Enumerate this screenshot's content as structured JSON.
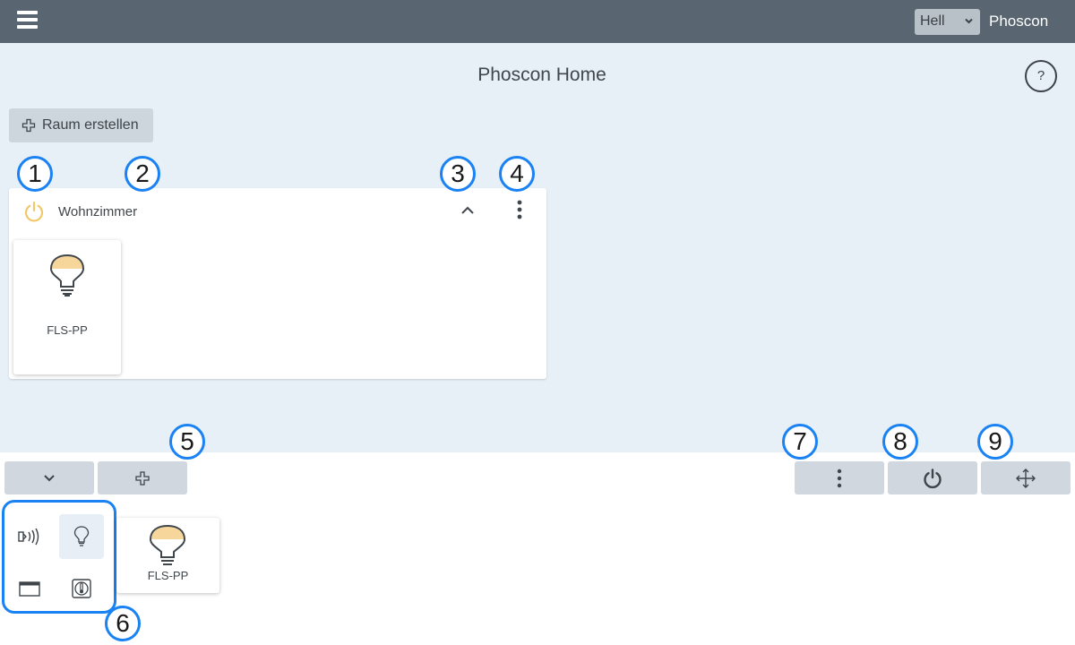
{
  "topbar": {
    "menu_icon": "hamburger-icon",
    "theme_select": {
      "value": "Hell"
    },
    "brand": "Phoscon"
  },
  "main": {
    "title": "Phoscon Home",
    "help_label": "?",
    "create_room_label": "Raum erstellen"
  },
  "room": {
    "name": "Wohnzimmer",
    "lights": [
      {
        "name": "FLS-PP"
      }
    ]
  },
  "bottom": {
    "categories": [
      "sensor-icon",
      "light-icon",
      "window-covering-icon",
      "thermostat-icon"
    ],
    "active_category": "light-icon",
    "lights": [
      {
        "name": "FLS-PP"
      }
    ]
  },
  "annotations": [
    "1",
    "2",
    "3",
    "4",
    "5",
    "6",
    "7",
    "8",
    "9"
  ],
  "colors": {
    "topbar": "#596570",
    "background": "#e7eff7",
    "accent": "#1a82f2",
    "bulb": "#f6d69a",
    "button": "#d0d7de"
  }
}
